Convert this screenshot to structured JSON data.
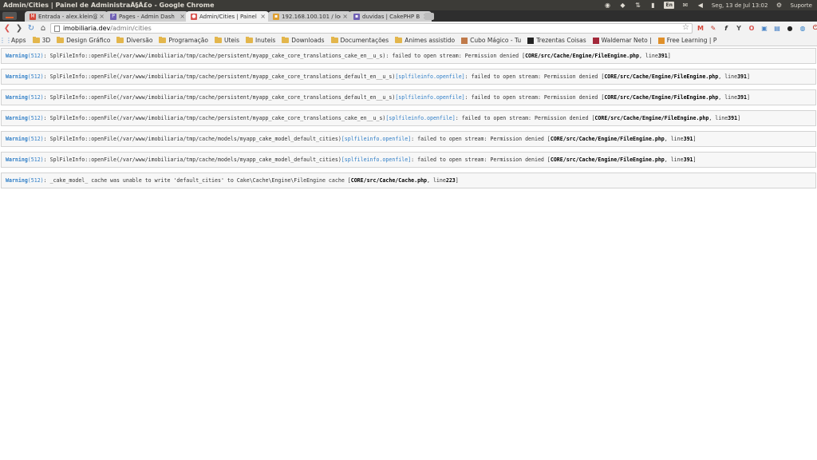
{
  "os_bar": {
    "window_title": "Admin/Cities | Painel de AdministraÃ§Ã£o - Google Chrome",
    "lang": "En",
    "clock": "Seg, 13 de Jul 13:02",
    "user": "Suporte"
  },
  "tabs": [
    {
      "label": "Entrada - alex.klein@",
      "fav_color": "#d44638",
      "fav_glyph": "M"
    },
    {
      "label": "Pages - Admin Dash",
      "fav_color": "#6f5fb5",
      "fav_glyph": "P"
    },
    {
      "label": "Admin/Cities | Painel",
      "fav_color": "#d9534f",
      "fav_glyph": "●",
      "active": true
    },
    {
      "label": "192.168.100.101 / loc",
      "fav_color": "#e0a030",
      "fav_glyph": "▪"
    },
    {
      "label": "duvidas | CakePHP B",
      "fav_color": "#6f5fb5",
      "fav_glyph": "▪"
    }
  ],
  "address": {
    "host": "imobiliaria.dev",
    "path": "/admin/cities"
  },
  "bookmarks": [
    {
      "label": "Apps",
      "type": "apps"
    },
    {
      "label": "3D",
      "type": "folder"
    },
    {
      "label": "Design Gráfico",
      "type": "folder"
    },
    {
      "label": "Diversão",
      "type": "folder"
    },
    {
      "label": "Programação",
      "type": "folder"
    },
    {
      "label": "Uteis",
      "type": "folder"
    },
    {
      "label": "Inuteis",
      "type": "folder"
    },
    {
      "label": "Downloads",
      "type": "folder"
    },
    {
      "label": "Documentações",
      "type": "folder"
    },
    {
      "label": "Animes assistido",
      "type": "folder"
    },
    {
      "label": "Cubo Mágico - Tu",
      "type": "site",
      "color": "#c07a4a"
    },
    {
      "label": "Trezentas Coisas",
      "type": "site",
      "color": "#222"
    },
    {
      "label": "Waldemar Neto |",
      "type": "site",
      "color": "#a3283a"
    },
    {
      "label": "Free Learning | P",
      "type": "site",
      "color": "#e0902a"
    }
  ],
  "warnings": [
    {
      "label": "Warning",
      "code": "(512)",
      "text": ": SplFileInfo::openFile(/var/www/imobiliaria/tmp/cache/persistent/myapp_cake_core_translations_cake_en__u_s): failed to open stream: Permission denied [",
      "link": "",
      "file": "CORE/src/Cache/Engine/FileEngine.php",
      "line_text": ", line ",
      "line": "391",
      "end": "]"
    },
    {
      "label": "Warning",
      "code": "(512)",
      "text": ": SplFileInfo::openFile(/var/www/imobiliaria/tmp/cache/persistent/myapp_cake_core_translations_default_en__u_s) ",
      "link": "[splfileinfo.openfile]",
      "text2": ": failed to open stream: Permission denied [",
      "file": "CORE/src/Cache/Engine/FileEngine.php",
      "line_text": ", line ",
      "line": "391",
      "end": "]"
    },
    {
      "label": "Warning",
      "code": "(512)",
      "text": ": SplFileInfo::openFile(/var/www/imobiliaria/tmp/cache/persistent/myapp_cake_core_translations_default_en__u_s) ",
      "link": "[splfileinfo.openfile]",
      "text2": ": failed to open stream: Permission denied [",
      "file": "CORE/src/Cache/Engine/FileEngine.php",
      "line_text": ", line ",
      "line": "391",
      "end": "]"
    },
    {
      "label": "Warning",
      "code": "(512)",
      "text": ": SplFileInfo::openFile(/var/www/imobiliaria/tmp/cache/persistent/myapp_cake_core_translations_cake_en__u_s) ",
      "link": "[splfileinfo.openfile]",
      "text2": ": failed to open stream: Permission denied [",
      "file": "CORE/src/Cache/Engine/FileEngine.php",
      "line_text": ", line ",
      "line": "391",
      "end": "]"
    },
    {
      "label": "Warning",
      "code": "(512)",
      "text": ": SplFileInfo::openFile(/var/www/imobiliaria/tmp/cache/models/myapp_cake_model_default_cities) ",
      "link": "[splfileinfo.openfile]",
      "text2": ": failed to open stream: Permission denied [",
      "file": "CORE/src/Cache/Engine/FileEngine.php",
      "line_text": ", line ",
      "line": "391",
      "end": "]"
    },
    {
      "label": "Warning",
      "code": "(512)",
      "text": ": SplFileInfo::openFile(/var/www/imobiliaria/tmp/cache/models/myapp_cake_model_default_cities) ",
      "link": "[splfileinfo.openfile]",
      "text2": ": failed to open stream: Permission denied [",
      "file": "CORE/src/Cache/Engine/FileEngine.php",
      "line_text": ", line ",
      "line": "391",
      "end": "]"
    },
    {
      "label": "Warning",
      "code": "(512)",
      "text": ": _cake_model_ cache was unable to write 'default_cities' to Cake\\Cache\\Engine\\FileEngine cache [",
      "link": "",
      "file": "CORE/src/Cache/Cache.php",
      "line_text": ", line ",
      "line": "223",
      "end": "]"
    }
  ]
}
